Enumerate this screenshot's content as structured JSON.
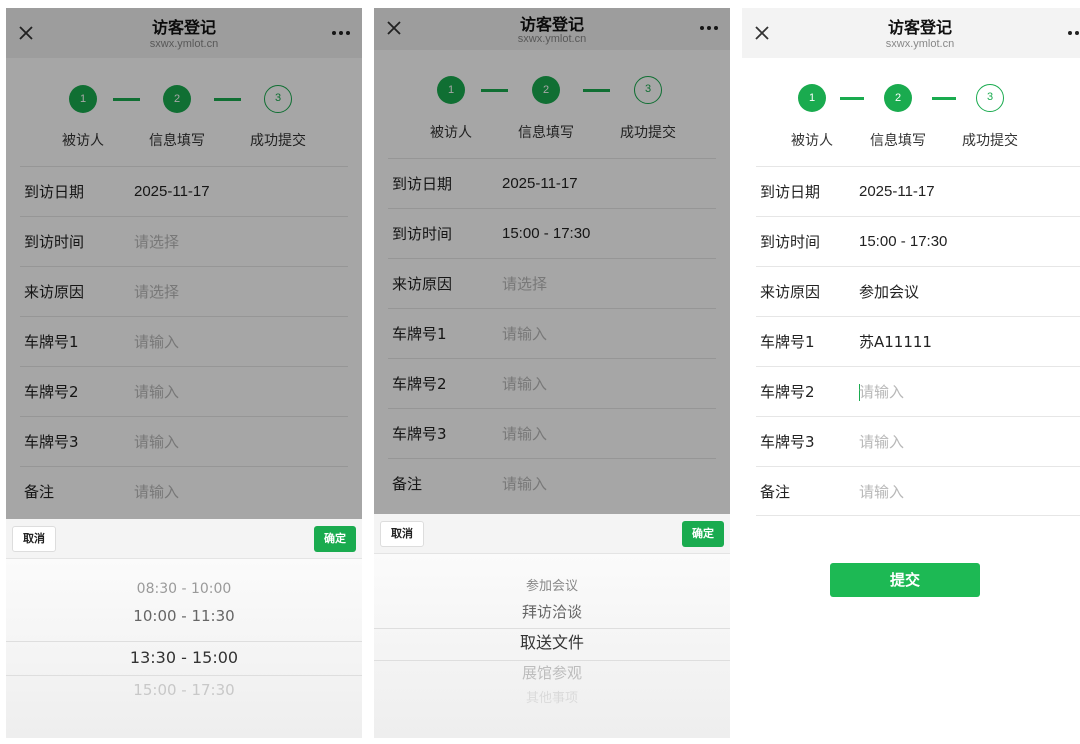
{
  "colors": {
    "accent": "#1aab4f",
    "submit": "#1db954",
    "placeholder": "#b8b8b8"
  },
  "icons": {
    "close": "close-icon",
    "more": "more-dots-icon"
  },
  "screens": [
    {
      "header": {
        "title": "访客登记",
        "subtitle": "sxwx.ymlot.cn"
      },
      "steps": [
        {
          "num": "1",
          "label": "被访人"
        },
        {
          "num": "2",
          "label": "信息填写"
        },
        {
          "num": "3",
          "label": "成功提交"
        }
      ],
      "rows": [
        {
          "label": "到访日期",
          "value": "2025-11-17"
        },
        {
          "label": "到访时间",
          "value": "请选择"
        },
        {
          "label": "来访原因",
          "value": "请选择"
        },
        {
          "label": "车牌号1",
          "value": "请输入"
        },
        {
          "label": "车牌号2",
          "value": "请输入"
        },
        {
          "label": "车牌号3",
          "value": "请输入"
        },
        {
          "label": "备注",
          "value": "请输入"
        }
      ],
      "picker": {
        "cancel": "取消",
        "confirm": "确定",
        "options": [
          "08:30 - 10:00",
          "10:00 - 11:30",
          "13:30 - 15:00",
          "15:00 - 17:30"
        ]
      }
    },
    {
      "header": {
        "title": "访客登记",
        "subtitle": "sxwx.ymlot.cn"
      },
      "steps": [
        {
          "num": "1",
          "label": "被访人"
        },
        {
          "num": "2",
          "label": "信息填写"
        },
        {
          "num": "3",
          "label": "成功提交"
        }
      ],
      "rows": [
        {
          "label": "到访日期",
          "value": "2025-11-17"
        },
        {
          "label": "到访时间",
          "value": "15:00 - 17:30"
        },
        {
          "label": "来访原因",
          "value": "请选择"
        },
        {
          "label": "车牌号1",
          "value": "请输入"
        },
        {
          "label": "车牌号2",
          "value": "请输入"
        },
        {
          "label": "车牌号3",
          "value": "请输入"
        },
        {
          "label": "备注",
          "value": "请输入"
        }
      ],
      "picker": {
        "cancel": "取消",
        "confirm": "确定",
        "options": [
          "参加会议",
          "拜访洽谈",
          "取送文件",
          "展馆参观",
          "其他事项"
        ]
      }
    },
    {
      "header": {
        "title": "访客登记",
        "subtitle": "sxwx.ymlot.cn"
      },
      "steps": [
        {
          "num": "1",
          "label": "被访人"
        },
        {
          "num": "2",
          "label": "信息填写"
        },
        {
          "num": "3",
          "label": "成功提交"
        }
      ],
      "rows": [
        {
          "label": "到访日期",
          "value": "2025-11-17"
        },
        {
          "label": "到访时间",
          "value": "15:00 - 17:30"
        },
        {
          "label": "来访原因",
          "value": "参加会议"
        },
        {
          "label": "车牌号1",
          "value": "苏A11111"
        },
        {
          "label": "车牌号2",
          "value": "请输入"
        },
        {
          "label": "车牌号3",
          "value": "请输入"
        },
        {
          "label": "备注",
          "value": "请输入"
        }
      ],
      "submit": "提交"
    }
  ]
}
